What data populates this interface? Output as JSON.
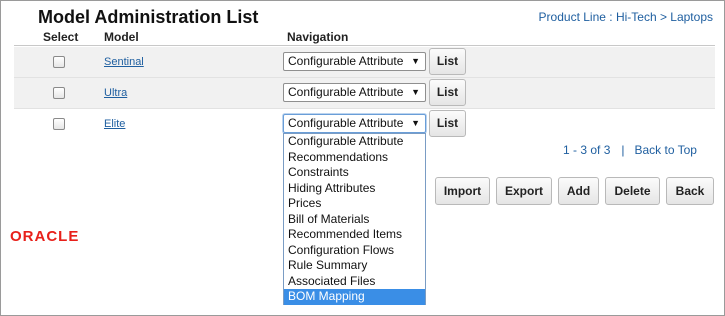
{
  "header": {
    "title": "Model Administration List",
    "breadcrumb": {
      "prefix": "Product Line : ",
      "path": "Hi-Tech > Laptops"
    }
  },
  "table": {
    "columns": [
      "Select",
      "Model",
      "Navigation"
    ],
    "rows": [
      {
        "model": "Sentinal",
        "navigation": "Configurable Attribute",
        "button": "List"
      },
      {
        "model": "Ultra",
        "navigation": "Configurable Attribute",
        "button": "List"
      },
      {
        "model": "Elite",
        "navigation": "Configurable Attribute",
        "button": "List"
      }
    ]
  },
  "dropdown": {
    "options": [
      "Configurable Attribute",
      "Recommendations",
      "Constraints",
      "Hiding Attributes",
      "Prices",
      "Bill of Materials",
      "Recommended Items",
      "Configuration Flows",
      "Rule Summary",
      "Associated Files",
      "BOM Mapping"
    ],
    "highlighted": "BOM Mapping"
  },
  "pager": {
    "range": "1 - 3 of 3",
    "separator": "|",
    "back_to_top": "Back to Top"
  },
  "actions": {
    "import": "Import",
    "export": "Export",
    "add": "Add",
    "delete": "Delete",
    "back": "Back"
  },
  "logo": {
    "text": "ORACLE"
  },
  "icons": {
    "dropdown_arrow": "chevron-down-icon"
  },
  "colors": {
    "link": "#1f5fa0",
    "highlight": "#3a8ee6",
    "logo": "#e8201a"
  }
}
